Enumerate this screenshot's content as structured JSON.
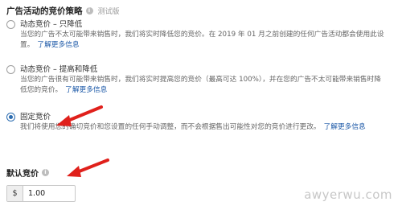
{
  "header": {
    "title": "广告活动的竞价策略",
    "beta": "测试版"
  },
  "options": [
    {
      "label": "动态竞价 – 只降低",
      "desc": "当您的广告不太可能带来销售时，我们将实时降低您的竞价。在 2019 年 01 月之前创建的任何广告活动都会使用此设置。",
      "link": "了解更多信息",
      "selected": false
    },
    {
      "label": "动态竞价 – 提高和降低",
      "desc": "当您的广告很有可能带来销售时，我们将实时提高您的竞价（最高可达 100%），并在您的广告不太可能带来销售时降低您的竞价。",
      "link": "了解更多信息",
      "selected": false
    },
    {
      "label": "固定竞价",
      "desc": "我们将使用您的确切竞价和您设置的任何手动调整，而不会根据售出可能性对您的竞价进行更改。",
      "link": "了解更多信息",
      "selected": true
    }
  ],
  "default_bid": {
    "label": "默认竞价",
    "currency": "$",
    "value": "1.00"
  },
  "watermark": "awyerwu.com",
  "colors": {
    "arrow": "#e0201b",
    "link": "#1e5aa8",
    "radio_selected": "#2b6cb0"
  }
}
